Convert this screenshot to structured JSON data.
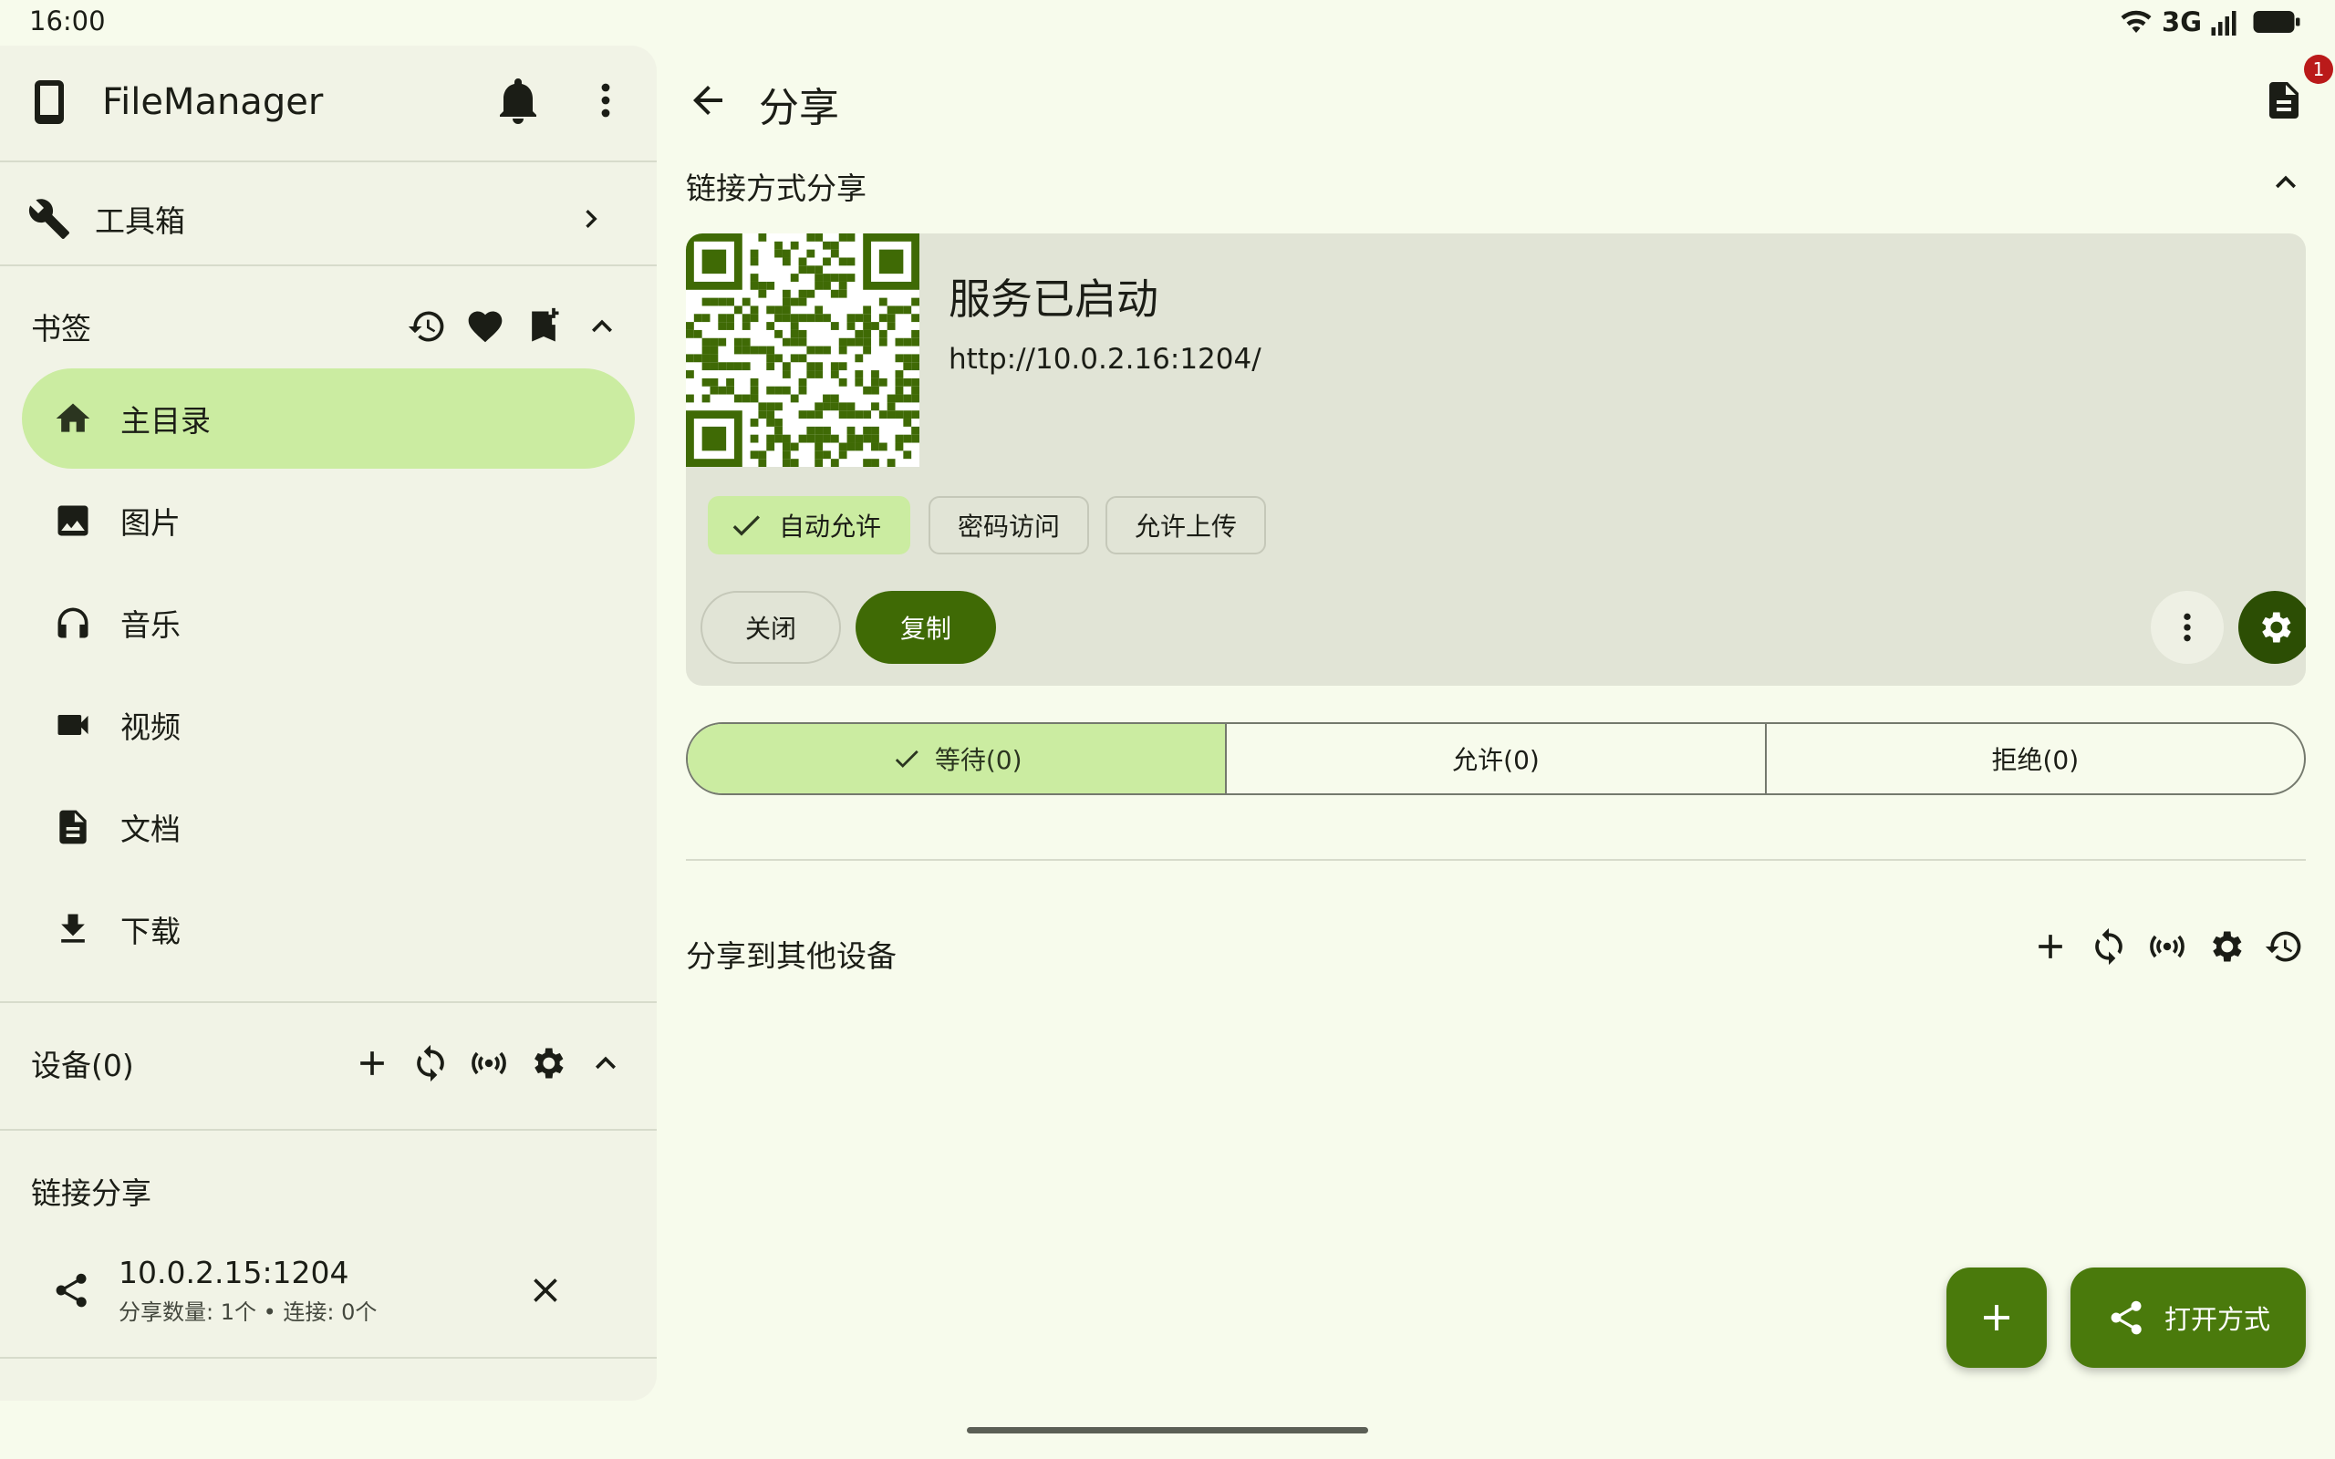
{
  "status_bar": {
    "time": "16:00",
    "network": "3G"
  },
  "drawer": {
    "app_title": "FileManager",
    "toolbox_label": "工具箱",
    "bookmarks_label": "书签",
    "nav_items": [
      {
        "label": "主目录",
        "icon": "home-icon",
        "active": true
      },
      {
        "label": "图片",
        "icon": "image-icon",
        "active": false
      },
      {
        "label": "音乐",
        "icon": "headphones-icon",
        "active": false
      },
      {
        "label": "视频",
        "icon": "videocam-icon",
        "active": false
      },
      {
        "label": "文档",
        "icon": "document-icon",
        "active": false
      },
      {
        "label": "下载",
        "icon": "download-icon",
        "active": false
      }
    ],
    "devices_label": "设备(0)",
    "link_share_label": "链接分享",
    "share_entry": {
      "address": "10.0.2.15:1204",
      "detail": "分享数量: 1个 • 连接: 0个"
    }
  },
  "main": {
    "title": "分享",
    "notification_count": "1",
    "link_section_label": "链接方式分享",
    "card": {
      "status": "服务已启动",
      "url": "http://10.0.2.16:1204/",
      "chips": {
        "auto_allow": "自动允许",
        "password": "密码访问",
        "upload": "允许上传"
      },
      "close_label": "关闭",
      "copy_label": "复制"
    },
    "tabs": {
      "waiting": "等待(0)",
      "allowed": "允许(0)",
      "rejected": "拒绝(0)"
    },
    "other_devices_label": "分享到其他设备",
    "fab_open_label": "打开方式"
  },
  "colors": {
    "primary": "#3f6a05",
    "primary_container": "#cbeca1",
    "background": "#f7fbec",
    "drawer_bg": "#f1f3e6",
    "card_bg": "#e1e4d6",
    "badge": "#ba1a1a"
  }
}
